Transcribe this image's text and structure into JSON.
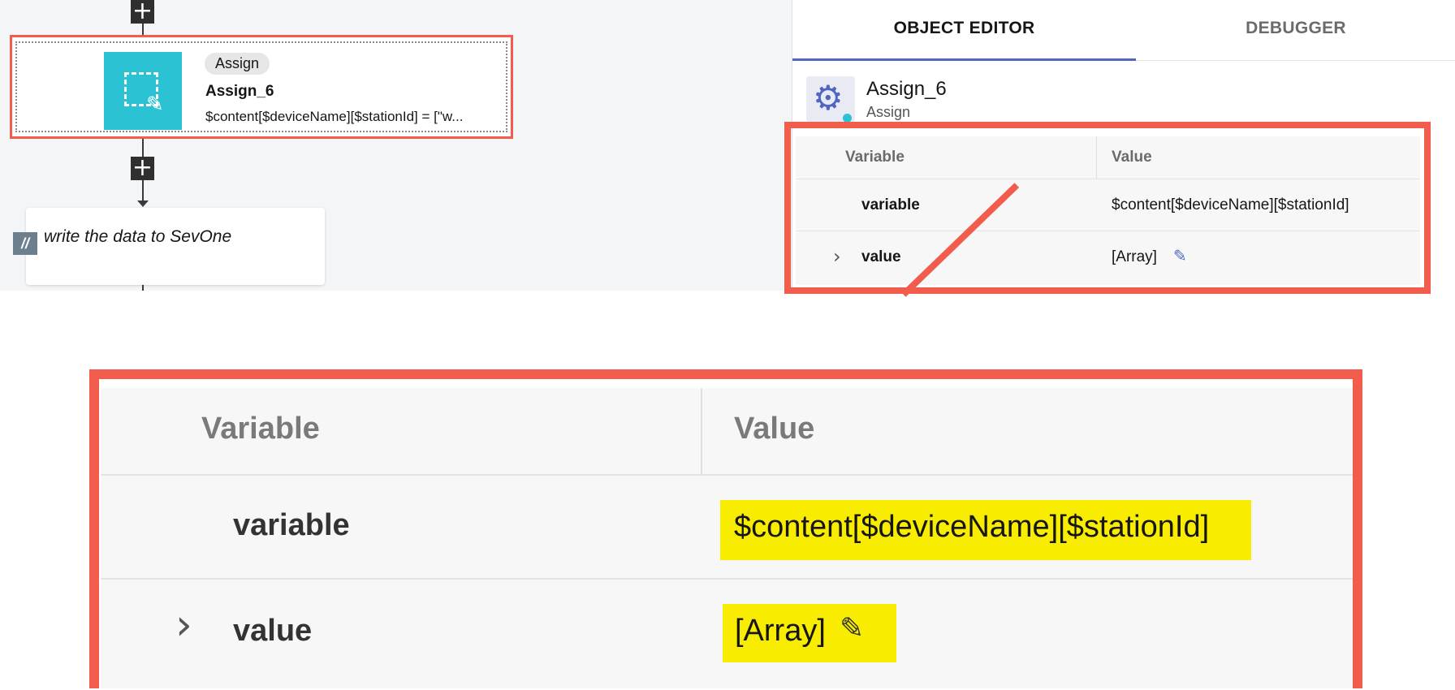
{
  "canvas": {
    "node": {
      "tag": "Assign",
      "title": "Assign_6",
      "description": "$content[$deviceName][$stationId] = [\"w..."
    },
    "comment": {
      "icon_label": "//",
      "text": "write the data to SevOne"
    },
    "add_step_glyph": "+"
  },
  "panel": {
    "tabs": [
      {
        "label": "OBJECT EDITOR",
        "active": true
      },
      {
        "label": "DEBUGGER",
        "active": false
      }
    ],
    "object": {
      "name": "Assign_6",
      "type": "Assign",
      "icon": "gear-icon"
    },
    "table": {
      "headers": [
        "Variable",
        "Value"
      ],
      "rows": [
        {
          "name": "variable",
          "value": "$content[$deviceName][$stationId]",
          "expandable": false
        },
        {
          "name": "value",
          "value": "[Array]",
          "expandable": true,
          "editable": true
        }
      ]
    }
  },
  "zoom": {
    "headers": [
      "Variable",
      "Value"
    ],
    "rows": [
      {
        "name": "variable",
        "value": "$content[$deviceName][$stationId]"
      },
      {
        "name": "value",
        "value": "[Array]"
      }
    ]
  },
  "colors": {
    "highlight_border": "#f25c4c",
    "assign_icon_bg": "#2bc3d4",
    "accent": "#5066c0",
    "yellow_highlight": "#f8ec00"
  }
}
